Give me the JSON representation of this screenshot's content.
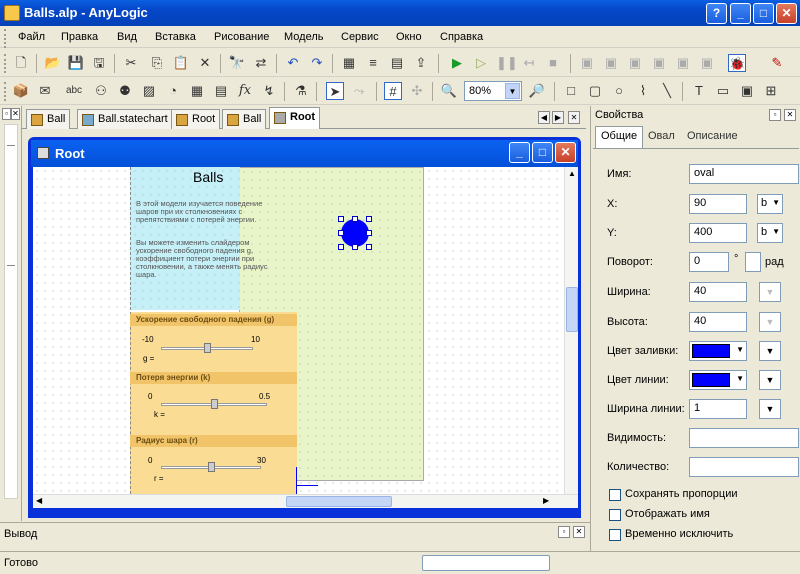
{
  "window": {
    "title": "Balls.alp - AnyLogic"
  },
  "menu": [
    "Файл",
    "Правка",
    "Вид",
    "Вставка",
    "Рисование",
    "Модель",
    "Сервис",
    "Окно",
    "Справка"
  ],
  "toolbar": {
    "abc_label": "abc",
    "fx_label": "fx",
    "zoom": "80%"
  },
  "tabs": [
    {
      "label": "Ball"
    },
    {
      "label": "Ball.statechart"
    },
    {
      "label": "Root"
    },
    {
      "label": "Ball"
    },
    {
      "label": "Root"
    }
  ],
  "inner_window": {
    "title": "Root"
  },
  "canvas": {
    "heading": "Balls",
    "description": "В этой модели изучается поведение шаров при их столкновениях с препятствиями с потерей энергии.",
    "description2": "Вы можете изменить слайдером ускорение свободного падения g, коэффициент потери энергии при столкновении, а также менять радиус шара.",
    "sliders": [
      {
        "title": "Ускорение свободного падения (g)",
        "min": "-10",
        "max": "10",
        "var": "g =",
        "value_fraction": 0.5
      },
      {
        "title": "Потеря энергии (k)",
        "min": "0",
        "max": "0.5",
        "var": "k =",
        "value_fraction": 0.5
      },
      {
        "title": "Радиус шара (r)",
        "min": "0",
        "max": "30",
        "var": "r =",
        "value_fraction": 0.5
      }
    ]
  },
  "output": {
    "label": "Вывод"
  },
  "status": {
    "text": "Готово"
  },
  "props": {
    "title": "Свойства",
    "tabs": [
      "Общие",
      "Овал",
      "Описание"
    ],
    "name_label": "Имя:",
    "name_value": "oval",
    "x_label": "X:",
    "x_value": "90",
    "x_unit": "b",
    "y_label": "Y:",
    "y_value": "400",
    "y_unit": "b",
    "rotation_label": "Поворот:",
    "rotation_value": "0",
    "degree": "°",
    "rad": "рад",
    "width_label": "Ширина:",
    "width_value": "40",
    "height_label": "Высота:",
    "height_value": "40",
    "fill_label": "Цвет заливки:",
    "line_label": "Цвет линии:",
    "linewidth_label": "Ширина линии:",
    "linewidth_value": "1",
    "visible_label": "Видимость:",
    "count_label": "Количество:",
    "checks": [
      "Сохранять пропорции",
      "Отображать имя",
      "Временно исключить"
    ],
    "color_blue": "#0000ff"
  }
}
